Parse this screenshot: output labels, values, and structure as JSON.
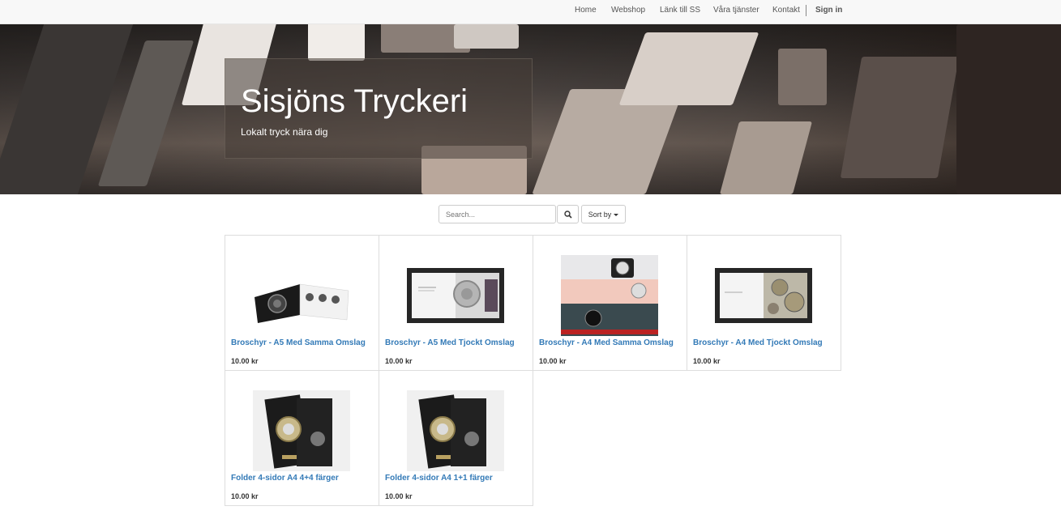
{
  "nav": {
    "items": [
      "Home",
      "Webshop",
      "Länk till SS",
      "Våra tjänster",
      "Kontakt"
    ],
    "signin": "Sign in"
  },
  "hero": {
    "title": "Sisjöns Tryckeri",
    "subtitle": "Lokalt tryck nära dig"
  },
  "search": {
    "placeholder": "Search...",
    "search_icon": "magnifier-icon",
    "sort_label": "Sort by"
  },
  "products": [
    {
      "name": "Broschyr - A5 Med Samma Omslag",
      "price": "10.00 kr",
      "thumb": "brochure-open-a5"
    },
    {
      "name": "Broschyr - A5 Med Tjockt Omslag",
      "price": "10.00 kr",
      "thumb": "brochure-spread-watch"
    },
    {
      "name": "Broschyr - A4 Med Samma Omslag",
      "price": "10.00 kr",
      "thumb": "brochure-watch-pages"
    },
    {
      "name": "Broschyr - A4 Med Tjockt Omslag",
      "price": "10.00 kr",
      "thumb": "brochure-spread-gears"
    },
    {
      "name": "Folder 4-sidor A4 4+4 färger",
      "price": "10.00 kr",
      "thumb": "folder-rolex"
    },
    {
      "name": "Folder 4-sidor A4 1+1 färger",
      "price": "10.00 kr",
      "thumb": "folder-rolex"
    }
  ]
}
